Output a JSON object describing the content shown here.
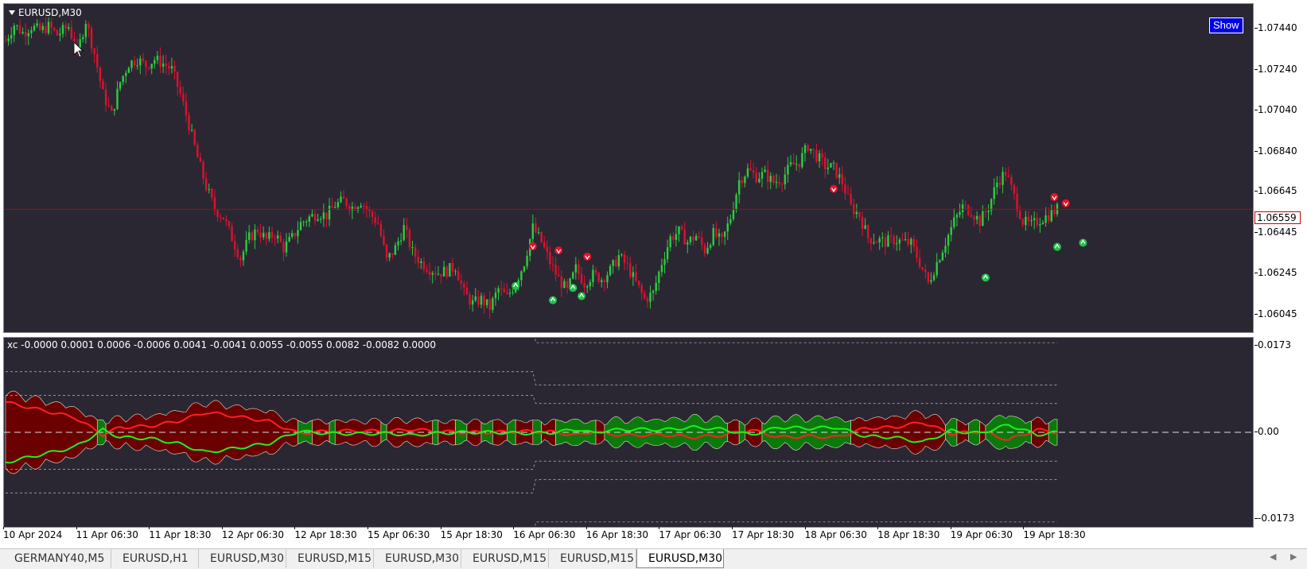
{
  "main_chart": {
    "title": "EURUSD,M30",
    "show_button": "Show",
    "current_price": "1.06559",
    "price_ticks": [
      "1.07440",
      "1.07240",
      "1.07040",
      "1.06840",
      "1.06645",
      "1.06445",
      "1.06245",
      "1.06045"
    ],
    "ylim": [
      1.0596,
      1.0756
    ]
  },
  "indicator": {
    "title": "xc  -0.0000 0.0001 0.0006 -0.0006 0.0041 -0.0041 0.0055 -0.0055 0.0082 -0.0082 0.0000",
    "ticks": [
      "0.0173",
      "0.00",
      "-0.0173"
    ]
  },
  "time_axis": [
    "10 Apr 2024",
    "11 Apr 06:30",
    "11 Apr 18:30",
    "12 Apr 06:30",
    "12 Apr 18:30",
    "15 Apr 06:30",
    "15 Apr 18:30",
    "16 Apr 06:30",
    "16 Apr 18:30",
    "17 Apr 06:30",
    "17 Apr 18:30",
    "18 Apr 06:30",
    "18 Apr 18:30",
    "19 Apr 06:30",
    "19 Apr 18:30"
  ],
  "tabs": [
    "GERMANY40,M5",
    "EURUSD,H1",
    "EURUSD,M30",
    "EURUSD,M15",
    "EURUSD,M30",
    "EURUSD,M15",
    "EURUSD,M15",
    "EURUSD,M30"
  ],
  "active_tab": 7,
  "colors": {
    "background": "#2a2733",
    "bull": "#2ecc40",
    "bear": "#e0102e",
    "price_line": "#c00000",
    "fill_red": "#6b0000",
    "fill_green": "#0b7a0b"
  },
  "chart_data": {
    "type": "line",
    "title": "",
    "price_path": [
      [
        0,
        1.0738
      ],
      [
        3,
        1.0746
      ],
      [
        6,
        1.0742
      ],
      [
        9,
        1.0745
      ],
      [
        12,
        1.0743
      ],
      [
        15,
        1.0745
      ],
      [
        18,
        1.0741
      ],
      [
        22,
        1.0745
      ],
      [
        25,
        1.0732
      ],
      [
        28,
        1.0748
      ],
      [
        31,
        1.0732
      ],
      [
        34,
        1.0712
      ],
      [
        37,
        1.0702
      ],
      [
        40,
        1.0718
      ],
      [
        43,
        1.0727
      ],
      [
        46,
        1.0729
      ],
      [
        49,
        1.0726
      ],
      [
        52,
        1.0729
      ],
      [
        55,
        1.0727
      ],
      [
        58,
        1.0724
      ],
      [
        61,
        1.0712
      ],
      [
        64,
        1.0697
      ],
      [
        67,
        1.0681
      ],
      [
        70,
        1.0667
      ],
      [
        73,
        1.0656
      ],
      [
        76,
        1.0652
      ],
      [
        79,
        1.0642
      ],
      [
        82,
        1.0632
      ],
      [
        85,
        1.0642
      ],
      [
        88,
        1.0646
      ],
      [
        91,
        1.0641
      ],
      [
        94,
        1.0644
      ],
      [
        97,
        1.0637
      ],
      [
        100,
        1.0642
      ],
      [
        103,
        1.0649
      ],
      [
        106,
        1.0652
      ],
      [
        109,
        1.0654
      ],
      [
        112,
        1.0653
      ],
      [
        115,
        1.0658
      ],
      [
        118,
        1.066
      ],
      [
        121,
        1.0657
      ],
      [
        124,
        1.066
      ],
      [
        127,
        1.0654
      ],
      [
        130,
        1.0649
      ],
      [
        133,
        1.0631
      ],
      [
        136,
        1.0637
      ],
      [
        139,
        1.0647
      ],
      [
        142,
        1.0635
      ],
      [
        145,
        1.063
      ],
      [
        148,
        1.0627
      ],
      [
        151,
        1.0625
      ],
      [
        154,
        1.0626
      ],
      [
        157,
        1.0628
      ],
      [
        160,
        1.0615
      ],
      [
        163,
        1.061
      ],
      [
        166,
        1.0612
      ],
      [
        169,
        1.0608
      ],
      [
        172,
        1.0617
      ],
      [
        175,
        1.0613
      ],
      [
        178,
        1.062
      ],
      [
        181,
        1.063
      ],
      [
        184,
        1.0647
      ],
      [
        187,
        1.064
      ],
      [
        190,
        1.063
      ],
      [
        193,
        1.0622
      ],
      [
        196,
        1.0616
      ],
      [
        199,
        1.0627
      ],
      [
        202,
        1.062
      ],
      [
        205,
        1.0624
      ],
      [
        208,
        1.0622
      ],
      [
        211,
        1.0626
      ],
      [
        214,
        1.0633
      ],
      [
        217,
        1.0628
      ],
      [
        220,
        1.062
      ],
      [
        223,
        1.0612
      ],
      [
        226,
        1.0615
      ],
      [
        229,
        1.063
      ],
      [
        232,
        1.0642
      ],
      [
        235,
        1.0645
      ],
      [
        238,
        1.064
      ],
      [
        241,
        1.0643
      ],
      [
        244,
        1.0636
      ],
      [
        247,
        1.0644
      ],
      [
        250,
        1.064
      ],
      [
        253,
        1.0652
      ],
      [
        256,
        1.067
      ],
      [
        259,
        1.0675
      ],
      [
        262,
        1.0672
      ],
      [
        265,
        1.0673
      ],
      [
        268,
        1.0669
      ],
      [
        271,
        1.0671
      ],
      [
        274,
        1.0677
      ],
      [
        277,
        1.0679
      ],
      [
        280,
        1.0687
      ],
      [
        283,
        1.0682
      ],
      [
        286,
        1.0677
      ],
      [
        289,
        1.0676
      ],
      [
        292,
        1.0669
      ],
      [
        295,
        1.0657
      ],
      [
        298,
        1.0653
      ],
      [
        301,
        1.0642
      ],
      [
        304,
        1.0641
      ],
      [
        307,
        1.064
      ],
      [
        310,
        1.0641
      ],
      [
        313,
        1.064
      ],
      [
        316,
        1.0639
      ],
      [
        319,
        1.063
      ],
      [
        322,
        1.062
      ],
      [
        325,
        1.063
      ],
      [
        328,
        1.064
      ],
      [
        331,
        1.065
      ],
      [
        334,
        1.0657
      ],
      [
        337,
        1.0655
      ],
      [
        340,
        1.065
      ],
      [
        343,
        1.0657
      ],
      [
        346,
        1.0669
      ],
      [
        349,
        1.0674
      ],
      [
        352,
        1.0662
      ],
      [
        355,
        1.065
      ],
      [
        358,
        1.0648
      ],
      [
        361,
        1.0651
      ],
      [
        364,
        1.0653
      ],
      [
        367,
        1.0656
      ]
    ],
    "osc_red": [
      [
        0,
        0.006
      ],
      [
        12,
        0.0045
      ],
      [
        24,
        0.003
      ],
      [
        34,
        -0.0005
      ],
      [
        40,
        0.001
      ],
      [
        50,
        0.0012
      ],
      [
        60,
        0.0022
      ],
      [
        70,
        0.004
      ],
      [
        80,
        0.0032
      ],
      [
        92,
        0.0022
      ],
      [
        102,
        -0.0002
      ],
      [
        112,
        0.0002
      ],
      [
        122,
        0.0003
      ],
      [
        134,
        0.0002
      ],
      [
        142,
        0.0006
      ],
      [
        150,
        0.0002
      ],
      [
        160,
        0.0
      ],
      [
        170,
        0.0
      ],
      [
        180,
        0.0002
      ],
      [
        190,
        0.0001
      ],
      [
        200,
        -0.0006
      ],
      [
        205,
        0.0002
      ],
      [
        210,
        -0.0004
      ],
      [
        220,
        -0.0006
      ],
      [
        230,
        -0.0005
      ],
      [
        240,
        -0.001
      ],
      [
        250,
        -0.0006
      ],
      [
        260,
        0.0005
      ],
      [
        270,
        -0.001
      ],
      [
        280,
        -0.0008
      ],
      [
        290,
        -0.001
      ],
      [
        300,
        0.0008
      ],
      [
        310,
        0.001
      ],
      [
        320,
        0.002
      ],
      [
        330,
        -0.0003
      ],
      [
        340,
        0.0002
      ],
      [
        350,
        -0.0015
      ],
      [
        360,
        0.0005
      ],
      [
        367,
        0.0
      ]
    ],
    "osc_green": [
      [
        0,
        -0.006
      ],
      [
        12,
        -0.0045
      ],
      [
        24,
        -0.003
      ],
      [
        34,
        0.0005
      ],
      [
        40,
        -0.001
      ],
      [
        50,
        -0.0012
      ],
      [
        60,
        -0.0022
      ],
      [
        70,
        -0.004
      ],
      [
        80,
        -0.0032
      ],
      [
        92,
        -0.0022
      ],
      [
        102,
        0.0002
      ],
      [
        112,
        -0.0002
      ],
      [
        122,
        -0.0003
      ],
      [
        134,
        -0.0002
      ],
      [
        142,
        -0.0006
      ],
      [
        150,
        -0.0002
      ],
      [
        160,
        0.0
      ],
      [
        170,
        0.0
      ],
      [
        180,
        -0.0002
      ],
      [
        190,
        -0.0001
      ],
      [
        200,
        0.0006
      ],
      [
        205,
        -0.0002
      ],
      [
        210,
        0.0004
      ],
      [
        220,
        0.0006
      ],
      [
        230,
        0.0005
      ],
      [
        240,
        0.001
      ],
      [
        250,
        0.0006
      ],
      [
        260,
        -0.0005
      ],
      [
        270,
        0.001
      ],
      [
        280,
        0.0008
      ],
      [
        290,
        0.001
      ],
      [
        300,
        -0.0008
      ],
      [
        310,
        -0.001
      ],
      [
        320,
        -0.002
      ],
      [
        330,
        0.0003
      ],
      [
        340,
        -0.0002
      ],
      [
        350,
        0.0015
      ],
      [
        360,
        -0.0005
      ],
      [
        367,
        0.0
      ]
    ],
    "ind_ylim": [
      -0.0173,
      0.0173
    ],
    "bands": [
      0.0041,
      -0.0041,
      0.0055,
      -0.0055,
      0.0082,
      -0.0082
    ],
    "up_arrows": [
      [
        178,
        1.0624
      ],
      [
        191,
        1.0617
      ],
      [
        198,
        1.0623
      ],
      [
        201,
        1.0619
      ],
      [
        342,
        1.0628
      ],
      [
        367,
        1.0643
      ],
      [
        376,
        1.0645
      ]
    ],
    "down_arrows": [
      [
        184,
        1.0634
      ],
      [
        193,
        1.0632
      ],
      [
        203,
        1.0629
      ],
      [
        289,
        1.0662
      ],
      [
        366,
        1.0658
      ],
      [
        370,
        1.0655
      ]
    ]
  }
}
